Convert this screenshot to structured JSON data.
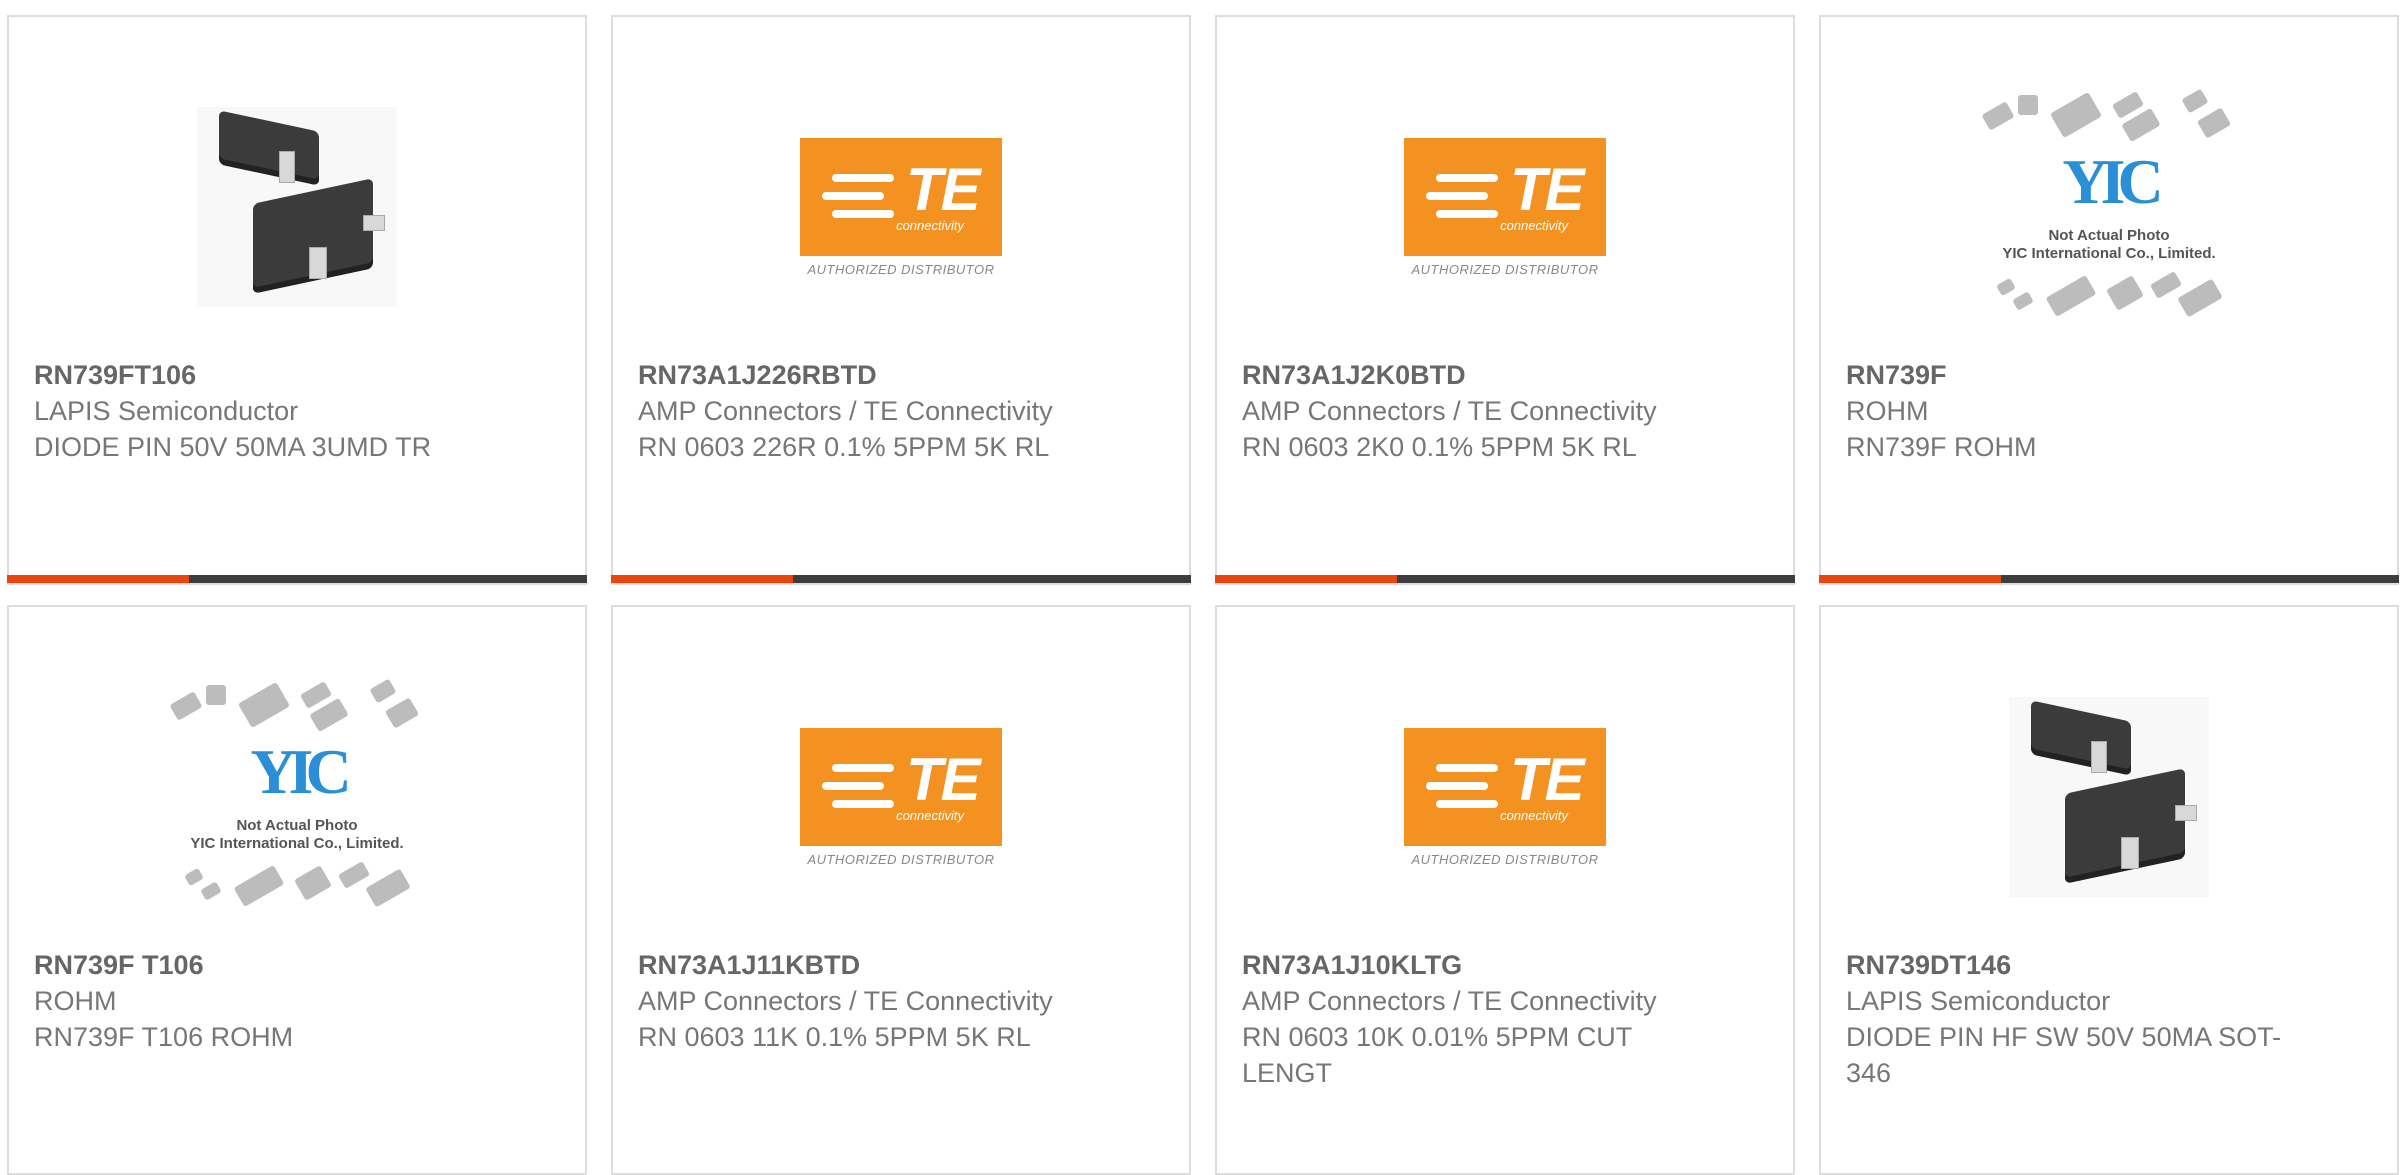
{
  "colors": {
    "accent": "#e8450f",
    "bar": "#3d3d3d",
    "te_orange": "#f39221",
    "yic_blue": "#2b8fd8"
  },
  "logo": {
    "te_mark": "TE",
    "te_sub": "connectivity",
    "te_dist": "AUTHORIZED DISTRIBUTOR",
    "yic_mark": "YIC",
    "yic_note_1": "Not Actual Photo",
    "yic_note_2": "YIC International Co., Limited."
  },
  "cards": [
    {
      "image": "sot-chip-image",
      "part": "RN739FT106",
      "manufacturer": "LAPIS Semiconductor",
      "description": "DIODE PIN 50V 50MA 3UMD TR"
    },
    {
      "image": "te-logo",
      "part": "RN73A1J226RBTD",
      "manufacturer": "AMP Connectors / TE Connectivity",
      "description": "RN 0603 226R 0.1% 5PPM 5K RL"
    },
    {
      "image": "te-logo",
      "part": "RN73A1J2K0BTD",
      "manufacturer": "AMP Connectors / TE Connectivity",
      "description": "RN 0603 2K0 0.1% 5PPM 5K RL"
    },
    {
      "image": "yic-placeholder",
      "part": "RN739F",
      "manufacturer": "ROHM",
      "description": "RN739F ROHM"
    },
    {
      "image": "yic-placeholder",
      "part": "RN739F T106",
      "manufacturer": "ROHM",
      "description": "RN739F T106 ROHM"
    },
    {
      "image": "te-logo",
      "part": "RN73A1J11KBTD",
      "manufacturer": "AMP Connectors / TE Connectivity",
      "description": "RN 0603 11K 0.1% 5PPM 5K RL"
    },
    {
      "image": "te-logo",
      "part": "RN73A1J10KLTG",
      "manufacturer": "AMP Connectors / TE Connectivity",
      "description": "RN 0603 10K 0.01% 5PPM CUT LENGT"
    },
    {
      "image": "sot-chip-image",
      "part": "RN739DT146",
      "manufacturer": "LAPIS Semiconductor",
      "description": "DIODE PIN HF SW 50V 50MA SOT-346"
    }
  ]
}
